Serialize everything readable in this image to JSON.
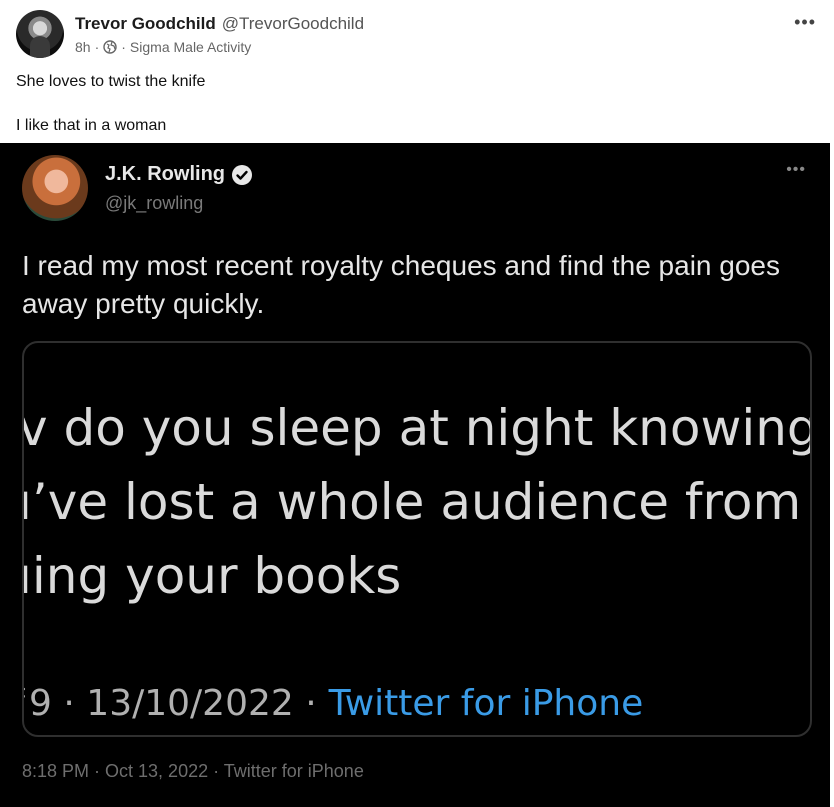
{
  "post": {
    "author_name": "Trevor Goodchild",
    "author_handle": "@TrevorGoodchild",
    "time": "8h",
    "separator": "·",
    "community": "Sigma Male Activity",
    "more_icon": "more-icon",
    "lines": [
      "She loves to twist the knife",
      "I like that in a woman"
    ]
  },
  "tweet": {
    "name": "J.K. Rowling",
    "handle": "@jk_rowling",
    "verified_icon": "verified-icon",
    "text": "I read my most recent royalty cheques and find the pain goes away pretty quickly.",
    "quote_lines": [
      "v do you sleep at night knowing",
      "ı’ve lost a whole audience from",
      "ıing your books"
    ],
    "quote_meta": "ʿ9 · 13/10/2022 ·",
    "quote_source": "Twitter for iPhone",
    "footer": "8:18 PM · Oct 13, 2022 · Twitter for iPhone"
  },
  "colors": {
    "tweet_background": "#000000",
    "link_blue": "#3a9be6"
  }
}
